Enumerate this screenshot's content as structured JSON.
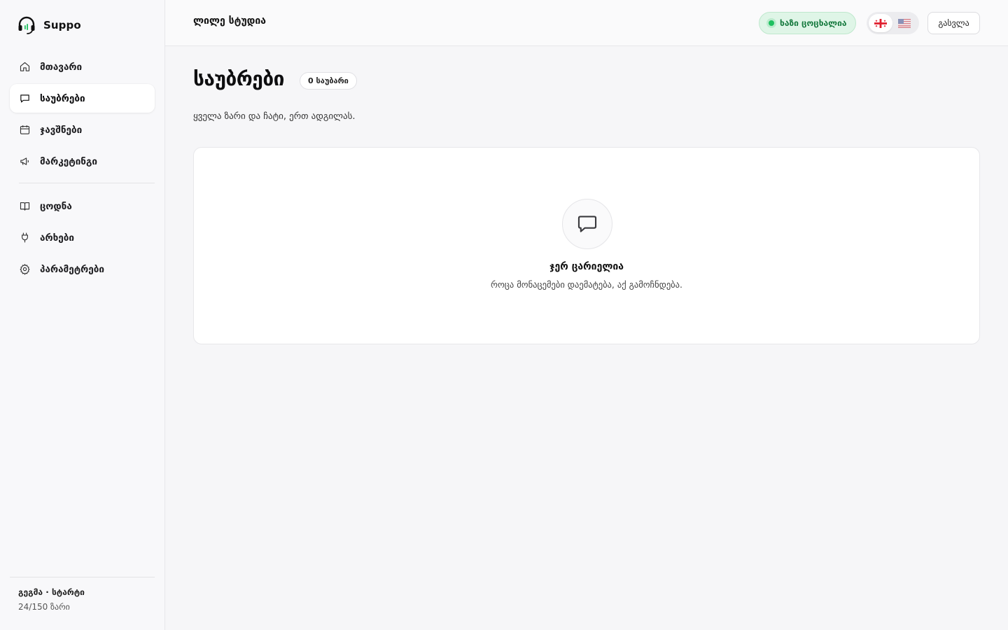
{
  "brand": {
    "name": "Suppo"
  },
  "sidebar": {
    "items": [
      {
        "label": "მთავარი",
        "icon": "home-icon"
      },
      {
        "label": "საუბრები",
        "icon": "chat-bubble-icon",
        "active": true
      },
      {
        "label": "ჯავშნები",
        "icon": "calendar-icon"
      },
      {
        "label": "მარკეტინგი",
        "icon": "megaphone-icon"
      },
      {
        "label": "ცოდნა",
        "icon": "book-icon"
      },
      {
        "label": "არხები",
        "icon": "plug-icon"
      },
      {
        "label": "პარამეტრები",
        "icon": "gear-icon"
      }
    ],
    "plan": {
      "title": "გეგმა · სტარტი",
      "usage": "24/150 ზარი"
    }
  },
  "header": {
    "title": "ლილე სტუდია",
    "status": "ხაზი ცოცხალია",
    "languages": [
      "georgian-flag-icon",
      "us-flag-icon"
    ],
    "logout": "გასვლა"
  },
  "main": {
    "title": "საუბრები",
    "count_badge": "0 საუბარი",
    "subtitle": "ყველა ზარი და ჩატი, ერთ ადგილას.",
    "empty": {
      "title": "ჯერ ცარიელია",
      "description": "როცა მონაცემები დაემატება, აქ გამოჩნდება."
    }
  },
  "colors": {
    "accent_green": "#1fc060",
    "status_bg": "#dff5e7",
    "status_text": "#177a3f"
  }
}
